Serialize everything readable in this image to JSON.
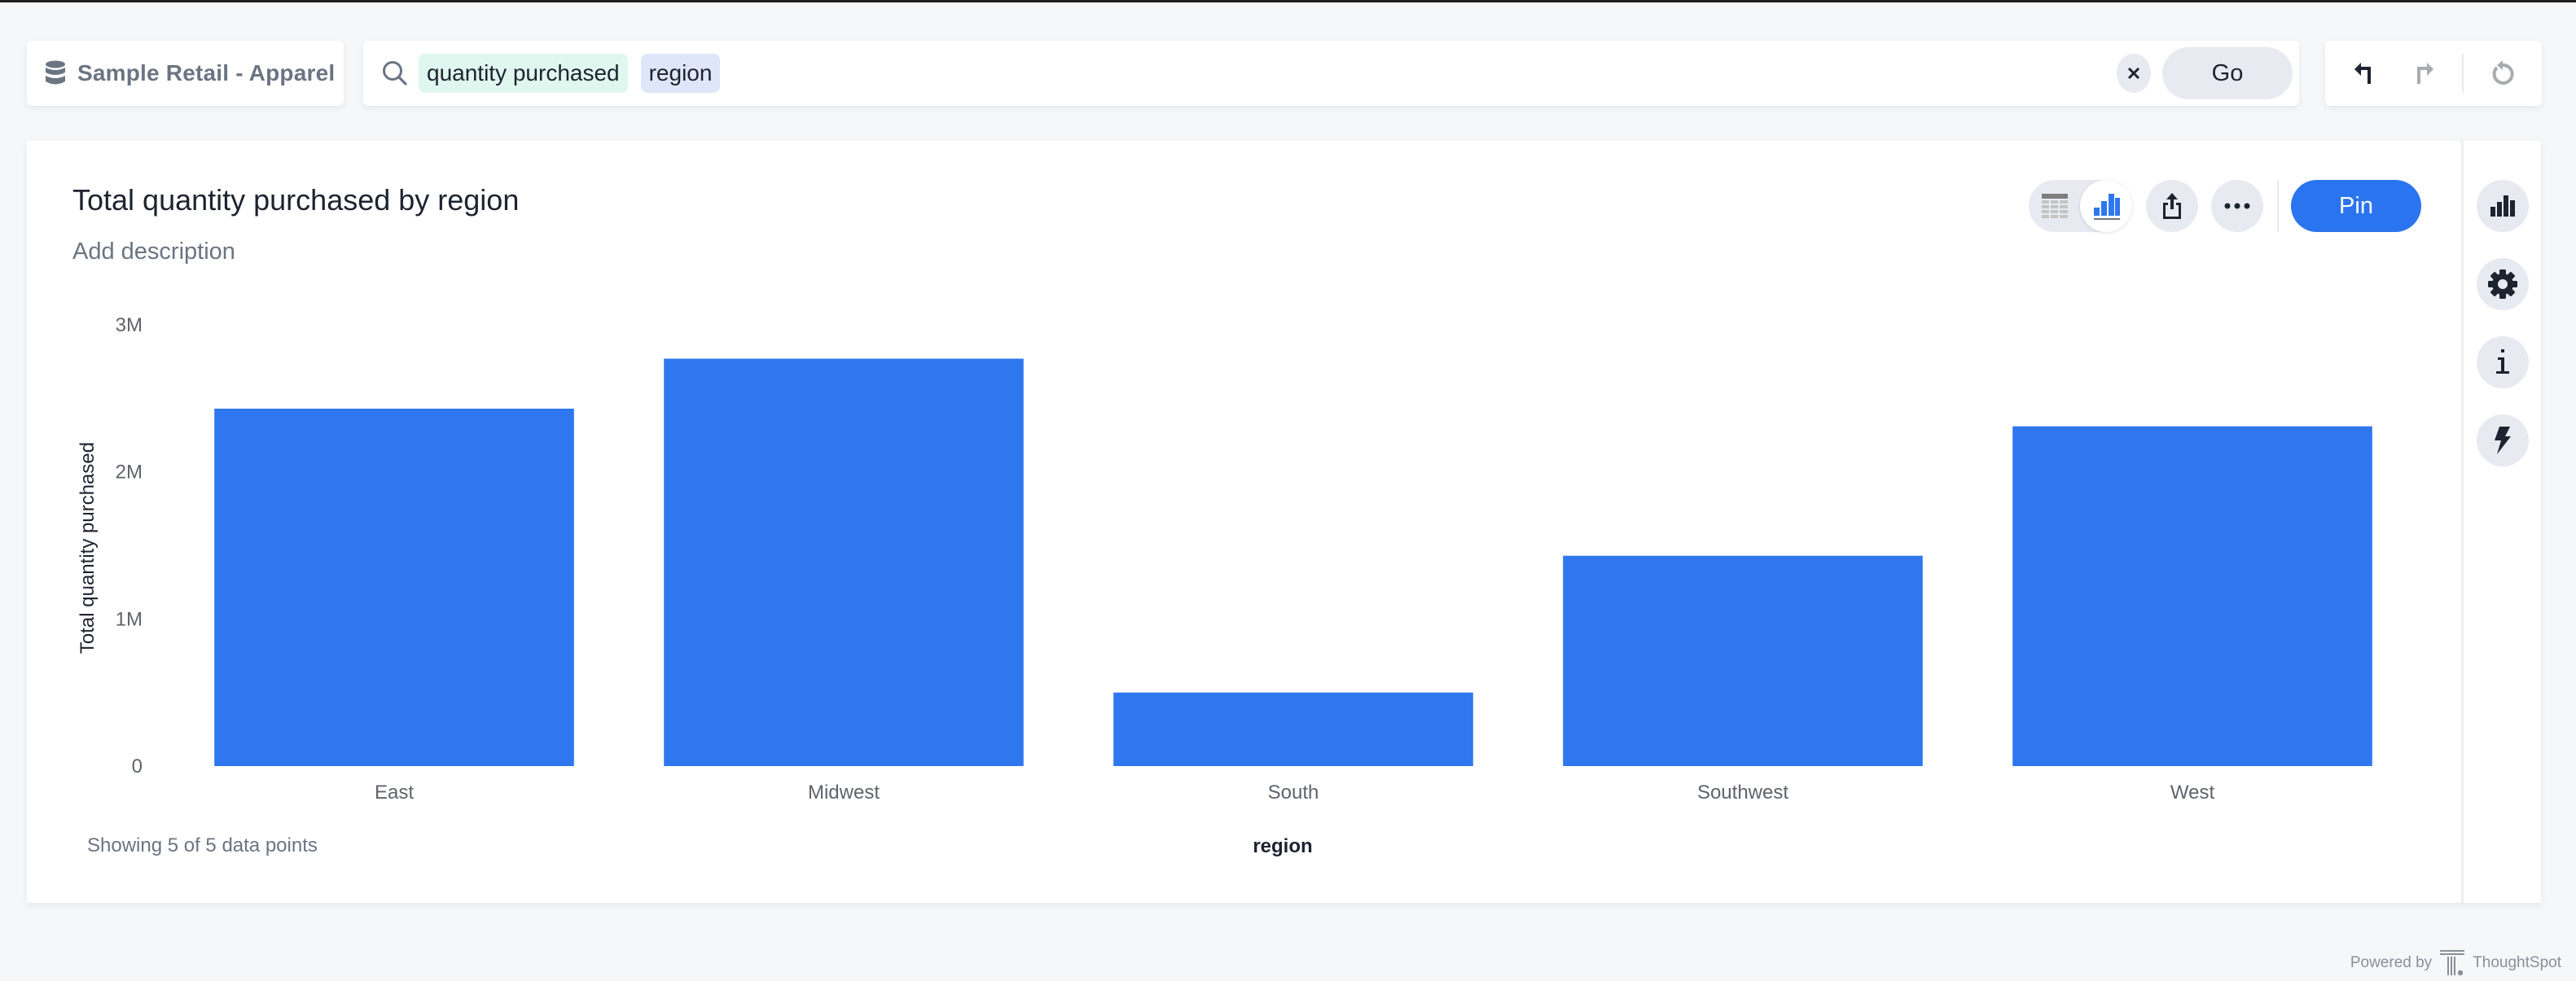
{
  "source": {
    "label": "Sample Retail - Apparel",
    "icon": "database-icon"
  },
  "search": {
    "tokens": [
      {
        "text": "quantity purchased",
        "kind": "measure",
        "color": "#dff7ee"
      },
      {
        "text": "region",
        "kind": "attribute",
        "color": "#dfe6f9"
      }
    ],
    "clear_icon": "close-icon",
    "go_label": "Go"
  },
  "history": {
    "undo_icon": "undo-icon",
    "redo_icon": "redo-icon",
    "reset_icon": "reset-icon",
    "redo_enabled": false,
    "reset_enabled": false
  },
  "card": {
    "title": "Total quantity purchased by region",
    "description_placeholder": "Add description",
    "toolbar": {
      "view_toggle": [
        {
          "icon": "table-icon",
          "active": false
        },
        {
          "icon": "bar-chart-icon",
          "active": true
        }
      ],
      "share_icon": "share-icon",
      "more_icon": "more-icon",
      "pin_label": "Pin"
    },
    "right_rail": [
      "chart-type-icon",
      "settings-gear-icon",
      "info-icon",
      "lightning-icon"
    ],
    "footer_note": "Showing 5 of 5 data points"
  },
  "powered_by": {
    "prefix": "Powered by",
    "brand": "ThoughtSpot"
  },
  "colors": {
    "accent": "#2b74ef",
    "bar": "#2e77ef",
    "page_bg": "#f6f7f9"
  },
  "chart_data": {
    "type": "bar",
    "title": "Total quantity purchased by region",
    "xlabel": "region",
    "ylabel": "Total quantity purchased",
    "categories": [
      "East",
      "Midwest",
      "South",
      "Southwest",
      "West"
    ],
    "values": [
      2430000,
      2770000,
      500000,
      1430000,
      2310000
    ],
    "ylim": [
      0,
      3000000
    ],
    "yticks": [
      0,
      1000000,
      2000000,
      3000000
    ],
    "ytick_labels": [
      "0",
      "1M",
      "2M",
      "3M"
    ],
    "grid": false,
    "legend": "none"
  }
}
